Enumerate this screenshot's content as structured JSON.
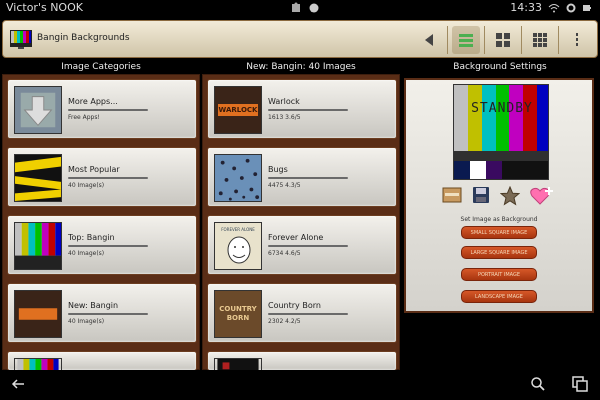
{
  "status": {
    "device": "Victor's NOOK",
    "time": "14:33"
  },
  "actionbar": {
    "title": "Bangin Backgrounds"
  },
  "columns": {
    "left_header": "Image Categories",
    "mid_header": "New: Bangin: 40 Images",
    "right_header": "Background Settings"
  },
  "left_cards": [
    {
      "title": "More Apps...",
      "sub": "Free Apps!"
    },
    {
      "title": "Most Popular",
      "sub": "40 Image(s)"
    },
    {
      "title": "Top: Bangin",
      "sub": "40 Image(s)"
    },
    {
      "title": "New: Bangin",
      "sub": "40 Image(s)"
    }
  ],
  "mid_cards": [
    {
      "title": "Warlock",
      "sub": "1613 3.6/5",
      "thumb_text": "WARLOCK"
    },
    {
      "title": "Bugs",
      "sub": "4475 4.3/5"
    },
    {
      "title": "Forever Alone",
      "sub": "6734 4.6/5",
      "thumb_text": "FOREVER ALONE"
    },
    {
      "title": "Country Born",
      "sub": "2302 4.2/5",
      "thumb_text": "COUNTRY BORN"
    }
  ],
  "settings": {
    "preview_text": "STANDBY",
    "set_label": "Set Image as Background",
    "buttons": [
      "SMALL SQUARE IMAGE",
      "LARGE SQUARE IMAGE",
      "PORTRAIT IMAGE",
      "LANDSCAPE IMAGE"
    ]
  }
}
